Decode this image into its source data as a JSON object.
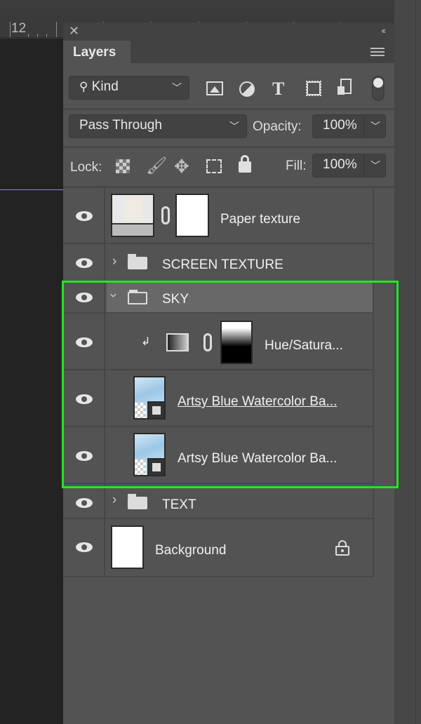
{
  "ruler": {
    "label": "12"
  },
  "panel": {
    "close_icon": "close-icon",
    "collapse_label": "‹‹",
    "tab": "Layers",
    "filter": {
      "value": "Kind",
      "icons": [
        "image-filter-icon",
        "adjustment-filter-icon",
        "type-filter-icon",
        "shape-filter-icon",
        "smart-object-filter-icon"
      ]
    },
    "blend_mode": "Pass Through",
    "opacity_label": "Opacity:",
    "opacity_value": "100%",
    "lock_label": "Lock:",
    "fill_label": "Fill:",
    "fill_value": "100%"
  },
  "layers": [
    {
      "name": "Paper texture",
      "visible": true,
      "type": "smart-filter-layer-with-mask"
    },
    {
      "name": "SCREEN TEXTURE",
      "visible": true,
      "type": "group",
      "expanded": false
    },
    {
      "name": "SKY",
      "visible": true,
      "type": "group",
      "expanded": true,
      "selected": true
    },
    {
      "name": "Hue/Satura...",
      "visible": true,
      "type": "adjustment",
      "clipped": true
    },
    {
      "name": "Artsy Blue Watercolor Ba...",
      "visible": true,
      "type": "smart-object",
      "underlined": true
    },
    {
      "name": "Artsy Blue Watercolor Ba...",
      "visible": true,
      "type": "smart-object"
    },
    {
      "name": "TEXT",
      "visible": true,
      "type": "group",
      "expanded": false
    },
    {
      "name": "Background",
      "visible": true,
      "type": "background",
      "locked": true
    }
  ],
  "colors": {
    "highlight": "#22e622",
    "panel": "#535353",
    "selected_row": "#686868"
  }
}
